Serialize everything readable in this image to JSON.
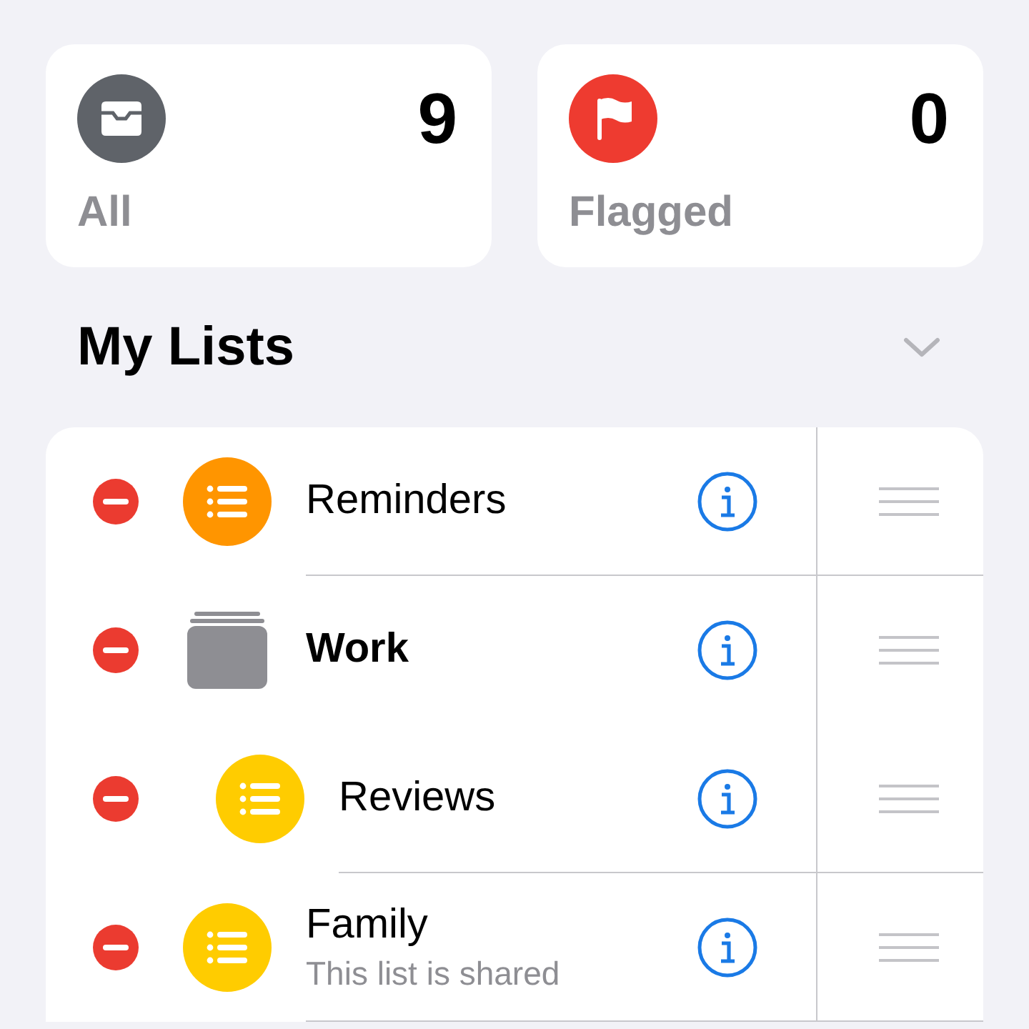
{
  "smart_lists": [
    {
      "kind": "all",
      "label": "All",
      "count": "9",
      "color": "#5f6369"
    },
    {
      "kind": "flagged",
      "label": "Flagged",
      "count": "0",
      "color": "#ee3b30"
    }
  ],
  "section": {
    "title": "My Lists"
  },
  "lists": [
    {
      "kind": "list",
      "name": "Reminders",
      "color": "#ff9500"
    },
    {
      "kind": "group",
      "name": "Work",
      "children": [
        {
          "kind": "list",
          "name": "Reviews",
          "color": "#ffcc00"
        }
      ]
    },
    {
      "kind": "list",
      "name": "Family",
      "color": "#ffcc00",
      "subtitle": "This list is shared"
    }
  ]
}
